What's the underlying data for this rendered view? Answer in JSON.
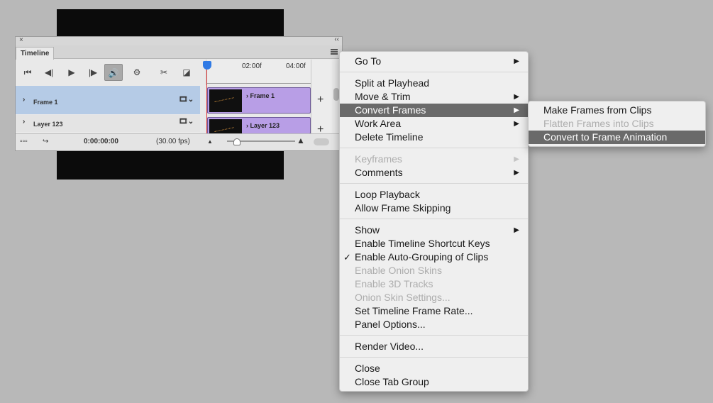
{
  "timeline_panel": {
    "close_glyph": "×",
    "collapse_glyph": "‹‹",
    "tab_label": "Timeline",
    "controls": {
      "go_first": "⏮",
      "step_back": "◀|",
      "play": "▶",
      "step_forward": "|▶",
      "audio": "🔊",
      "settings": "⚙",
      "split": "✂",
      "transition": "◪"
    },
    "ruler_ticks": [
      "02:00f",
      "04:00f"
    ],
    "tracks": [
      {
        "name": "Frame 1",
        "clip_label": "Frame 1"
      },
      {
        "name": "Layer 123",
        "clip_label": "Layer 123"
      }
    ],
    "add_glyph": "+",
    "timecode": "0:00:00:00",
    "fps": "(30.00 fps)"
  },
  "context_menu": {
    "items": [
      {
        "label": "Go To",
        "submenu": true,
        "enabled": true
      },
      {
        "label": "Split at Playhead",
        "enabled": true
      },
      {
        "label": "Move & Trim",
        "submenu": true,
        "enabled": true
      },
      {
        "label": "Convert Frames",
        "submenu": true,
        "enabled": true,
        "highlighted": true
      },
      {
        "label": "Work Area",
        "submenu": true,
        "enabled": true
      },
      {
        "label": "Delete Timeline",
        "enabled": true
      },
      {
        "label": "Keyframes",
        "submenu": true,
        "enabled": false
      },
      {
        "label": "Comments",
        "submenu": true,
        "enabled": true
      },
      {
        "label": "Loop Playback",
        "enabled": true
      },
      {
        "label": "Allow Frame Skipping",
        "enabled": true
      },
      {
        "label": "Show",
        "submenu": true,
        "enabled": true
      },
      {
        "label": "Enable Timeline Shortcut Keys",
        "enabled": true
      },
      {
        "label": "Enable Auto-Grouping of Clips",
        "enabled": true,
        "checked": true
      },
      {
        "label": "Enable Onion Skins",
        "enabled": false
      },
      {
        "label": "Enable 3D Tracks",
        "enabled": false
      },
      {
        "label": "Onion Skin Settings...",
        "enabled": false
      },
      {
        "label": "Set Timeline Frame Rate...",
        "enabled": true
      },
      {
        "label": "Panel Options...",
        "enabled": true
      },
      {
        "label": "Render Video...",
        "enabled": true
      },
      {
        "label": "Close",
        "enabled": true
      },
      {
        "label": "Close Tab Group",
        "enabled": true
      }
    ],
    "arrow_glyph": "▶",
    "check_glyph": "✓"
  },
  "submenu": {
    "items": [
      {
        "label": "Make Frames from Clips",
        "enabled": true
      },
      {
        "label": "Flatten Frames into Clips",
        "enabled": false
      },
      {
        "label": "Convert to Frame Animation",
        "enabled": true,
        "highlighted": true
      }
    ]
  },
  "colors": {
    "canvas_bg": "#b8b8b8",
    "highlight": "#6a6a6a",
    "clip_purple": "#b89ee6",
    "track_selected": "#b5cbe6",
    "playhead": "#2f7ae5"
  }
}
